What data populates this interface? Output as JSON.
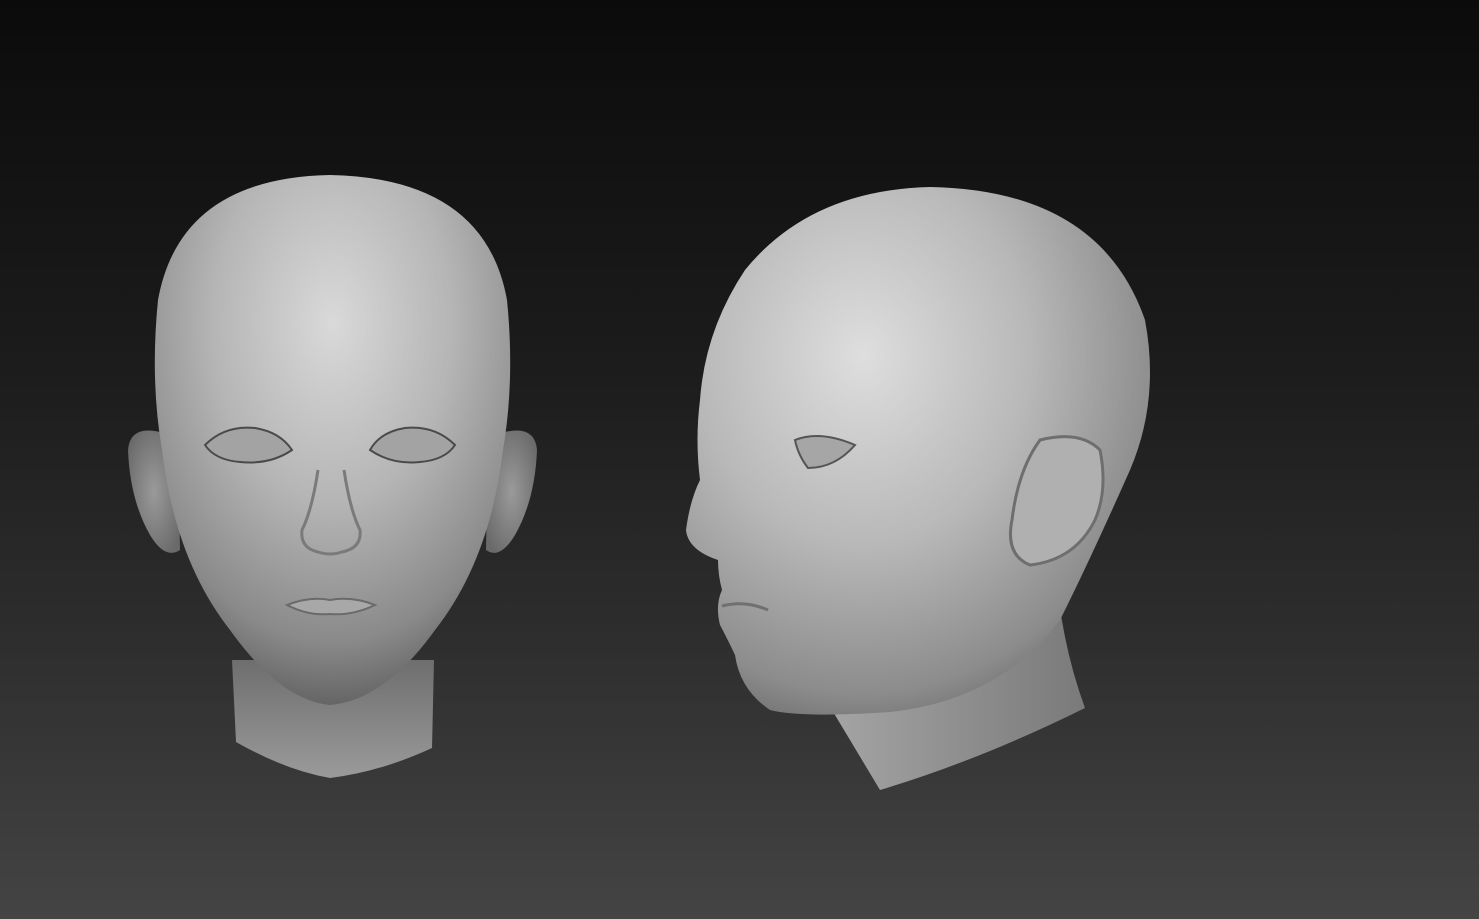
{
  "scene": {
    "background_top": "#0b0b0b",
    "background_bottom": "#444444",
    "material_color": "#bdbdbd",
    "models": [
      {
        "name": "front-view",
        "view": "front"
      },
      {
        "name": "side-view",
        "view": "three-quarter-left"
      }
    ]
  }
}
